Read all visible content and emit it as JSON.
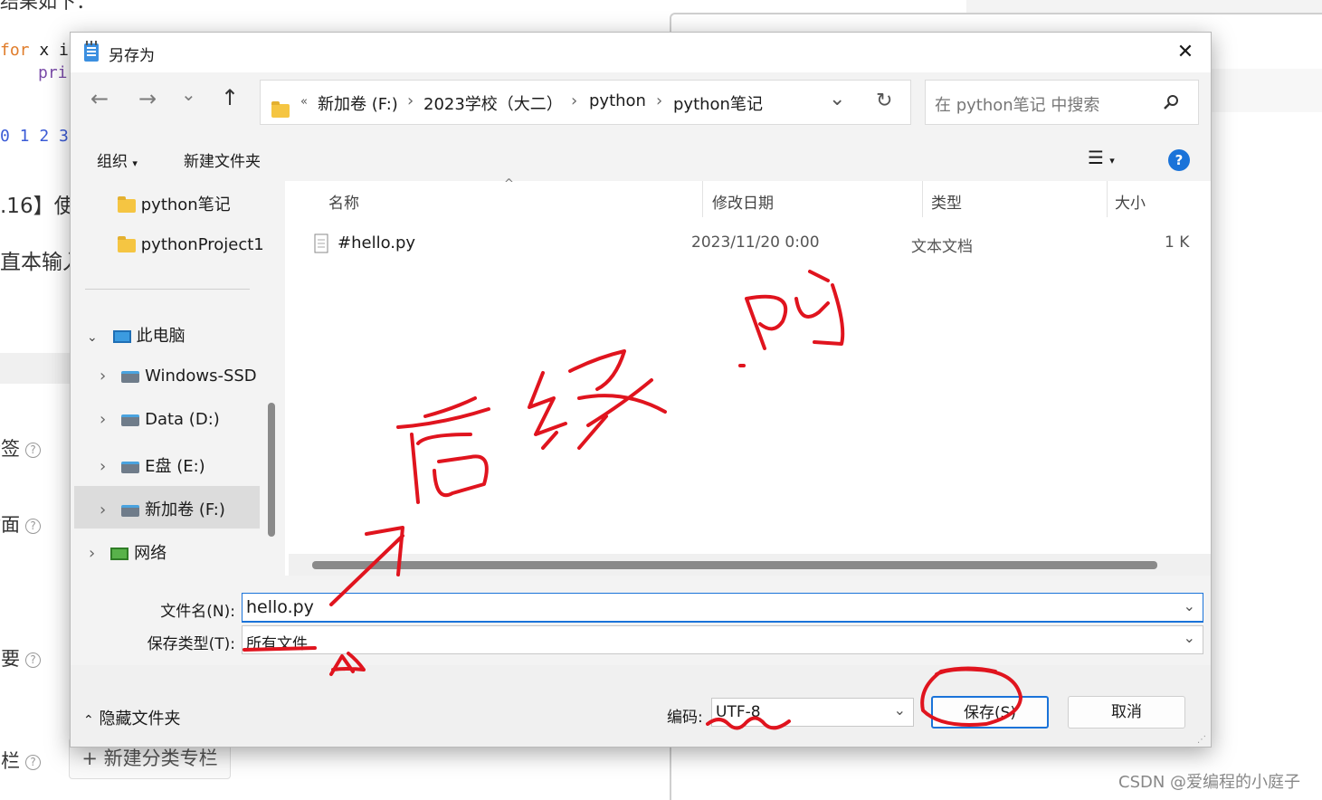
{
  "background": {
    "top_text": "结果如下：",
    "code_line1_keyword": "for",
    "code_line1_rest": "x i",
    "code_line2": "pri",
    "output": "0 1 2 3",
    "heading": ".16】使",
    "input_text": "直本输入",
    "labels": [
      "标签",
      "封面",
      "摘要",
      "专栏"
    ],
    "new_category_button": "+ 新建分类专栏",
    "watermark": "CSDN @爱编程的小庭子"
  },
  "dialog": {
    "title": "另存为",
    "close": "✕",
    "nav": {
      "back": "←",
      "forward": "→",
      "recent": "⌄",
      "up": "↑",
      "breadcrumb_prefix": "«",
      "breadcrumb": [
        "新加卷 (F:)",
        "2023学校（大二）",
        "python",
        "python笔记"
      ],
      "search_placeholder": "在 python笔记 中搜索"
    },
    "toolbar": {
      "organize": "组织",
      "new_folder": "新建文件夹",
      "help": "?"
    },
    "tree": [
      {
        "label": "python笔记",
        "icon": "folder-icon"
      },
      {
        "label": "pythonProject1",
        "icon": "folder-icon"
      },
      {
        "label": "此电脑",
        "icon": "pc-icon"
      },
      {
        "label": "Windows-SSD",
        "icon": "drive-icon"
      },
      {
        "label": "Data (D:)",
        "icon": "drive-icon"
      },
      {
        "label": "E盘 (E:)",
        "icon": "drive-icon"
      },
      {
        "label": "新加卷 (F:)",
        "icon": "drive-icon"
      },
      {
        "label": "网络",
        "icon": "network-icon"
      }
    ],
    "columns": [
      "名称",
      "修改日期",
      "类型",
      "大小"
    ],
    "files": [
      {
        "name": "#hello.py",
        "modified": "2023/11/20 0:00",
        "type": "文本文档",
        "size": "1 K"
      }
    ],
    "filename_label": "文件名(N):",
    "filename_value": "hello.py",
    "filetype_label": "保存类型(T):",
    "filetype_value": "所有文件",
    "hide_folders": "隐藏文件夹",
    "encoding_label": "编码:",
    "encoding_value": "UTF-8",
    "save": "保存(S)",
    "cancel": "取消"
  },
  "annotation": {
    "text": "后缀 .py",
    "color": "#e0141e"
  }
}
